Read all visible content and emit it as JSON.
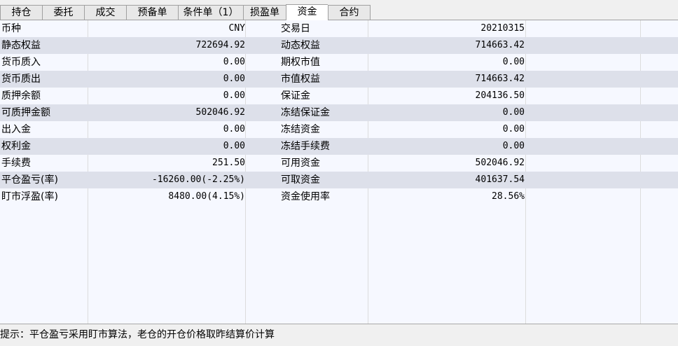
{
  "tabs": [
    {
      "label": "持仓",
      "active": false
    },
    {
      "label": "委托",
      "active": false
    },
    {
      "label": "成交",
      "active": false
    },
    {
      "label": "预备单",
      "active": false
    },
    {
      "label": "条件单（1）",
      "active": false
    },
    {
      "label": "损盈单",
      "active": false
    },
    {
      "label": "资金",
      "active": true
    },
    {
      "label": "合约",
      "active": false
    }
  ],
  "funds": {
    "rows": [
      {
        "label1": "币种",
        "value1": "CNY",
        "label2": "交易日",
        "value2": "20210315"
      },
      {
        "label1": "静态权益",
        "value1": "722694.92",
        "label2": "动态权益",
        "value2": "714663.42"
      },
      {
        "label1": "货币质入",
        "value1": "0.00",
        "label2": "期权市值",
        "value2": "0.00"
      },
      {
        "label1": "货币质出",
        "value1": "0.00",
        "label2": "市值权益",
        "value2": "714663.42"
      },
      {
        "label1": "质押余额",
        "value1": "0.00",
        "label2": "保证金",
        "value2": "204136.50"
      },
      {
        "label1": "可质押金额",
        "value1": "502046.92",
        "label2": "冻结保证金",
        "value2": "0.00"
      },
      {
        "label1": "出入金",
        "value1": "0.00",
        "label2": "冻结资金",
        "value2": "0.00"
      },
      {
        "label1": "权利金",
        "value1": "0.00",
        "label2": "冻结手续费",
        "value2": "0.00"
      },
      {
        "label1": "手续费",
        "value1": "251.50",
        "label2": "可用资金",
        "value2": "502046.92"
      },
      {
        "label1": "平仓盈亏(率)",
        "value1": "-16260.00(-2.25%)",
        "label2": "可取资金",
        "value2": "401637.54"
      },
      {
        "label1": "盯市浮盈(率)",
        "value1": "8480.00(4.15%)",
        "label2": "资金使用率",
        "value2": "28.56%"
      }
    ]
  },
  "status": {
    "hint": "提示：平仓盈亏采用盯市算法，老仓的开仓价格取昨结算价计算"
  },
  "colors": {
    "row_shade": "#dde0ea",
    "grid_bg": "#f6f8ff",
    "active_tab": "#ffffff"
  }
}
